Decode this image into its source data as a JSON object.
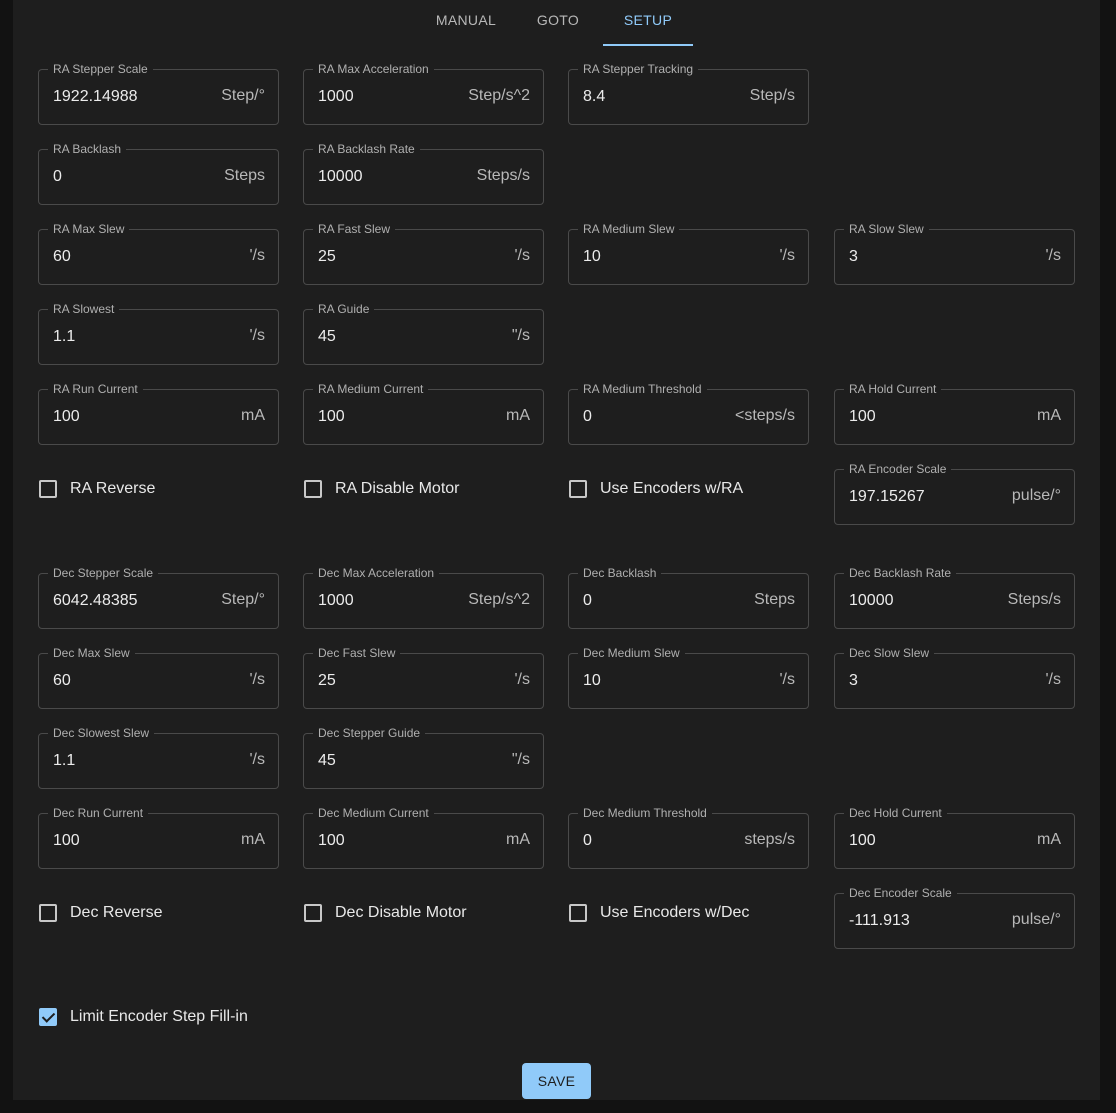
{
  "tabs": [
    "MANUAL",
    "GOTO",
    "SETUP"
  ],
  "ra": {
    "stepper_scale": {
      "label": "RA Stepper Scale",
      "value": "1922.14988",
      "unit": "Step/°"
    },
    "max_accel": {
      "label": "RA Max Acceleration",
      "value": "1000",
      "unit": "Step/s^2"
    },
    "tracking": {
      "label": "RA Stepper Tracking",
      "value": "8.4",
      "unit": "Step/s"
    },
    "backlash": {
      "label": "RA Backlash",
      "value": "0",
      "unit": "Steps"
    },
    "backlash_rate": {
      "label": "RA Backlash Rate",
      "value": "10000",
      "unit": "Steps/s"
    },
    "max_slew": {
      "label": "RA Max Slew",
      "value": "60",
      "unit": "'/s"
    },
    "fast_slew": {
      "label": "RA Fast Slew",
      "value": "25",
      "unit": "'/s"
    },
    "medium_slew": {
      "label": "RA Medium Slew",
      "value": "10",
      "unit": "'/s"
    },
    "slow_slew": {
      "label": "RA Slow Slew",
      "value": "3",
      "unit": "'/s"
    },
    "slowest": {
      "label": "RA Slowest",
      "value": "1.1",
      "unit": "'/s"
    },
    "guide": {
      "label": "RA Guide",
      "value": "45",
      "unit": "\"/s"
    },
    "run_current": {
      "label": "RA Run Current",
      "value": "100",
      "unit": "mA"
    },
    "medium_current": {
      "label": "RA Medium Current",
      "value": "100",
      "unit": "mA"
    },
    "medium_threshold": {
      "label": "RA Medium Threshold",
      "value": "0",
      "unit": "<steps/s"
    },
    "hold_current": {
      "label": "RA Hold Current",
      "value": "100",
      "unit": "mA"
    },
    "reverse": {
      "label": "RA Reverse",
      "checked": false
    },
    "disable_motor": {
      "label": "RA Disable Motor",
      "checked": false
    },
    "use_encoders": {
      "label": "Use Encoders w/RA",
      "checked": false
    },
    "encoder_scale": {
      "label": "RA Encoder Scale",
      "value": "197.15267",
      "unit": "pulse/°"
    }
  },
  "dec": {
    "stepper_scale": {
      "label": "Dec Stepper Scale",
      "value": "6042.48385",
      "unit": "Step/°"
    },
    "max_accel": {
      "label": "Dec Max Acceleration",
      "value": "1000",
      "unit": "Step/s^2"
    },
    "backlash": {
      "label": "Dec Backlash",
      "value": "0",
      "unit": "Steps"
    },
    "backlash_rate": {
      "label": "Dec Backlash Rate",
      "value": "10000",
      "unit": "Steps/s"
    },
    "max_slew": {
      "label": "Dec Max Slew",
      "value": "60",
      "unit": "'/s"
    },
    "fast_slew": {
      "label": "Dec Fast Slew",
      "value": "25",
      "unit": "'/s"
    },
    "medium_slew": {
      "label": "Dec Medium Slew",
      "value": "10",
      "unit": "'/s"
    },
    "slow_slew": {
      "label": "Dec Slow Slew",
      "value": "3",
      "unit": "'/s"
    },
    "slowest": {
      "label": "Dec Slowest Slew",
      "value": "1.1",
      "unit": "'/s"
    },
    "guide": {
      "label": "Dec Stepper Guide",
      "value": "45",
      "unit": "\"/s"
    },
    "run_current": {
      "label": "Dec Run Current",
      "value": "100",
      "unit": "mA"
    },
    "medium_current": {
      "label": "Dec Medium Current",
      "value": "100",
      "unit": "mA"
    },
    "medium_threshold": {
      "label": "Dec Medium Threshold",
      "value": "0",
      "unit": "steps/s"
    },
    "hold_current": {
      "label": "Dec Hold Current",
      "value": "100",
      "unit": "mA"
    },
    "reverse": {
      "label": "Dec Reverse",
      "checked": false
    },
    "disable_motor": {
      "label": "Dec Disable Motor",
      "checked": false
    },
    "use_encoders": {
      "label": "Use Encoders w/Dec",
      "checked": false
    },
    "encoder_scale": {
      "label": "Dec Encoder Scale",
      "value": "-111.913",
      "unit": "pulse/°"
    }
  },
  "limit_fill_in": {
    "label": "Limit Encoder Step Fill-in",
    "checked": true
  },
  "save_label": "SAVE",
  "colors": {
    "accent": "#90caf9",
    "panel": "#1e1e1e",
    "background": "#121212"
  }
}
